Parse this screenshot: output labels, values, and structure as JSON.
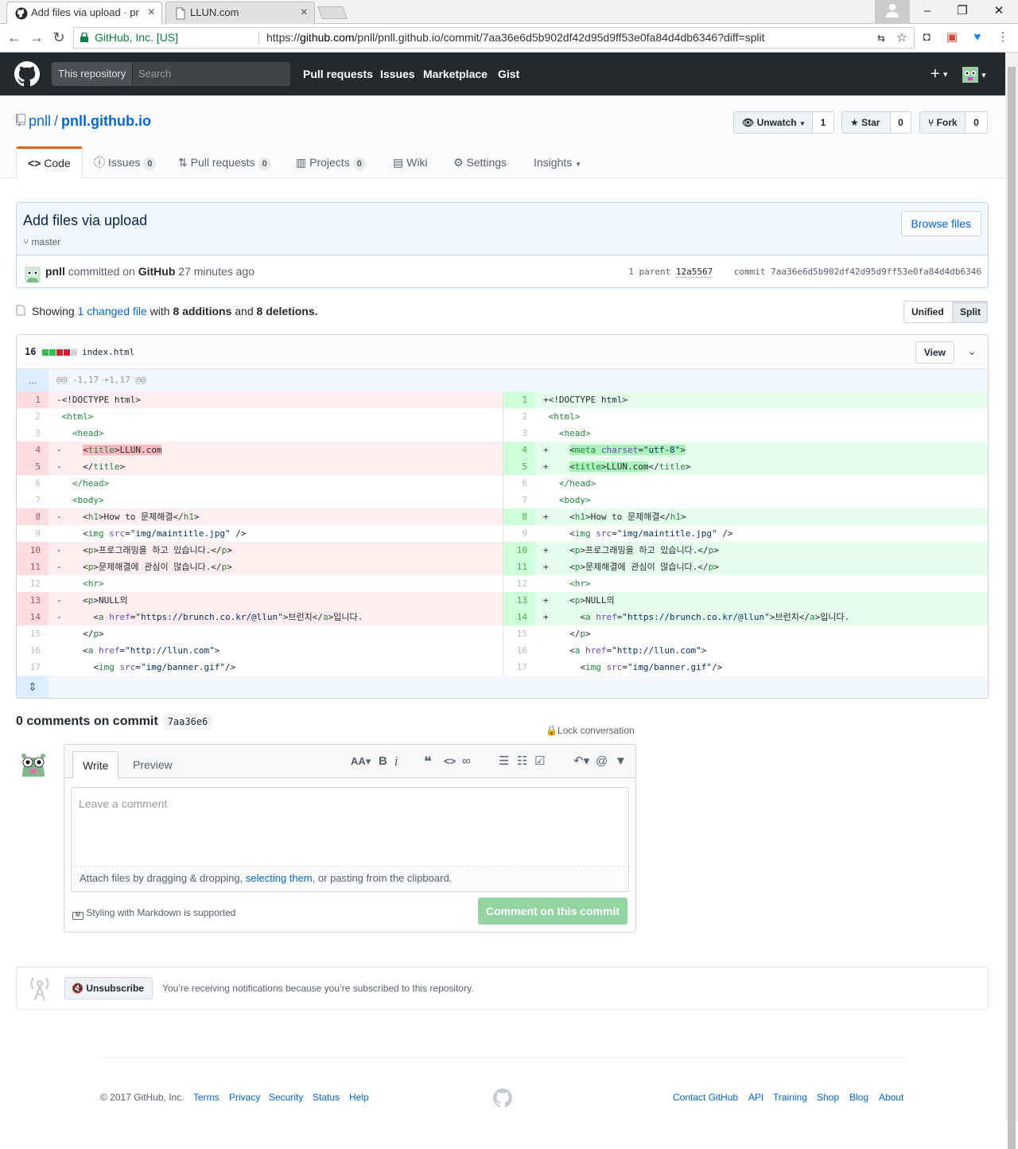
{
  "browser": {
    "tabs": [
      {
        "title": "Add files via upload · pr",
        "active": true
      },
      {
        "title": "LLUN.com",
        "active": false
      }
    ],
    "security_label": "GitHub, Inc. [US]",
    "url_scheme": "https://",
    "url_host": "github.com",
    "url_path": "/pnll/pnll.github.io/commit/7aa36e6d5b902df42d95d9ff53e0fa84d4db6346?diff=split"
  },
  "header": {
    "search_scope": "This repository",
    "search_placeholder": "Search",
    "nav": [
      "Pull requests",
      "Issues",
      "Marketplace",
      "Gist"
    ]
  },
  "repo": {
    "owner": "pnll",
    "name": "pnll.github.io",
    "watch_label": "Unwatch",
    "watch_count": "1",
    "star_label": "Star",
    "star_count": "0",
    "fork_label": "Fork",
    "fork_count": "0",
    "tabs": {
      "code": "Code",
      "issues": "Issues",
      "issues_count": "0",
      "pulls": "Pull requests",
      "pulls_count": "0",
      "projects": "Projects",
      "projects_count": "0",
      "wiki": "Wiki",
      "settings": "Settings",
      "insights": "Insights"
    }
  },
  "commit": {
    "title": "Add files via upload",
    "branch": "master",
    "browse_label": "Browse files",
    "author": "pnll",
    "committed_text": "committed on",
    "committer": "GitHub",
    "time": "27 minutes ago",
    "parent_label": "1 parent",
    "parent_sha": "12a5567",
    "commit_label": "commit",
    "sha": "7aa36e6d5b902df42d95d9ff53e0fa84d4db6346"
  },
  "summary": {
    "showing": "Showing",
    "changed": "1 changed file",
    "with": "with",
    "additions": "8 additions",
    "and": "and",
    "deletions": "8 deletions.",
    "unified_label": "Unified",
    "split_label": "Split"
  },
  "file": {
    "change_count": "16",
    "name": "index.html",
    "view_label": "View",
    "hunk": "@@ -1,17 +1,17 @@",
    "hunk_dots": "..."
  },
  "comments": {
    "heading": "0 comments on commit",
    "sha_short": "7aa36e6",
    "lock_label": "Lock conversation",
    "write_tab": "Write",
    "preview_tab": "Preview",
    "placeholder": "Leave a comment",
    "attach_pre": "Attach files by dragging & dropping,",
    "attach_link": "selecting them",
    "attach_post": ", or pasting from the clipboard.",
    "markdown_note": "Styling with Markdown is supported",
    "submit_label": "Comment on this commit"
  },
  "notifications": {
    "unsubscribe_label": "Unsubscribe",
    "message": "You’re receiving notifications because you’re subscribed to this repository."
  },
  "footer": {
    "copyright": "© 2017 GitHub, Inc.",
    "left_links": [
      "Terms",
      "Privacy",
      "Security",
      "Status",
      "Help"
    ],
    "right_links": [
      "Contact GitHub",
      "API",
      "Training",
      "Shop",
      "Blog",
      "About"
    ]
  },
  "colors": {
    "accent": "#0366d6",
    "header_bg": "#24292e",
    "deletion_bg": "#ffeef0",
    "addition_bg": "#e6ffed",
    "tab_accent": "#e36209",
    "submit_disabled": "#94d3a2"
  }
}
